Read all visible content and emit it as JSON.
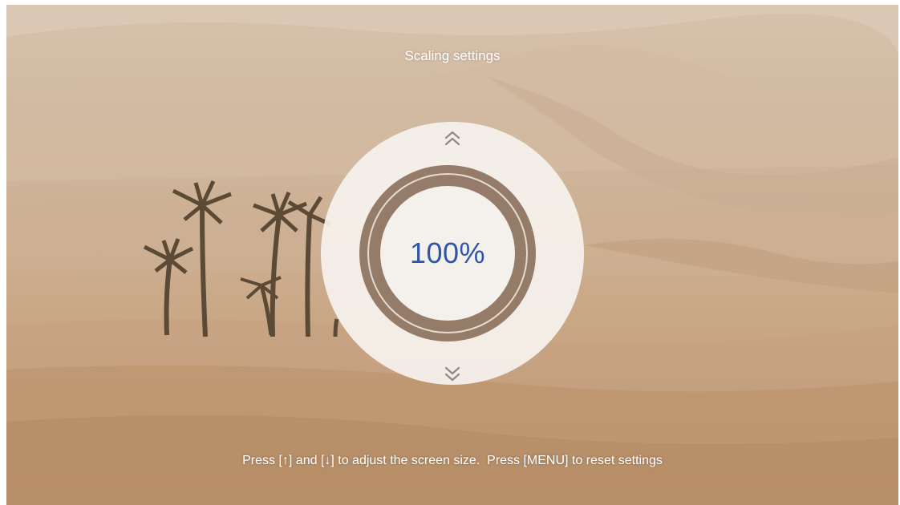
{
  "screen": {
    "title": "Scaling settings",
    "scale_value": "100%",
    "hint": "Press [↑] and [↓] to adjust the screen size.  Press [MENU] to reset settings"
  },
  "icons": {
    "increase": "double-chevron-up-icon",
    "decrease": "double-chevron-down-icon"
  },
  "colors": {
    "value_text": "#2e56a8",
    "dial_face": "#f4f0ec",
    "ring": "#876c58"
  }
}
